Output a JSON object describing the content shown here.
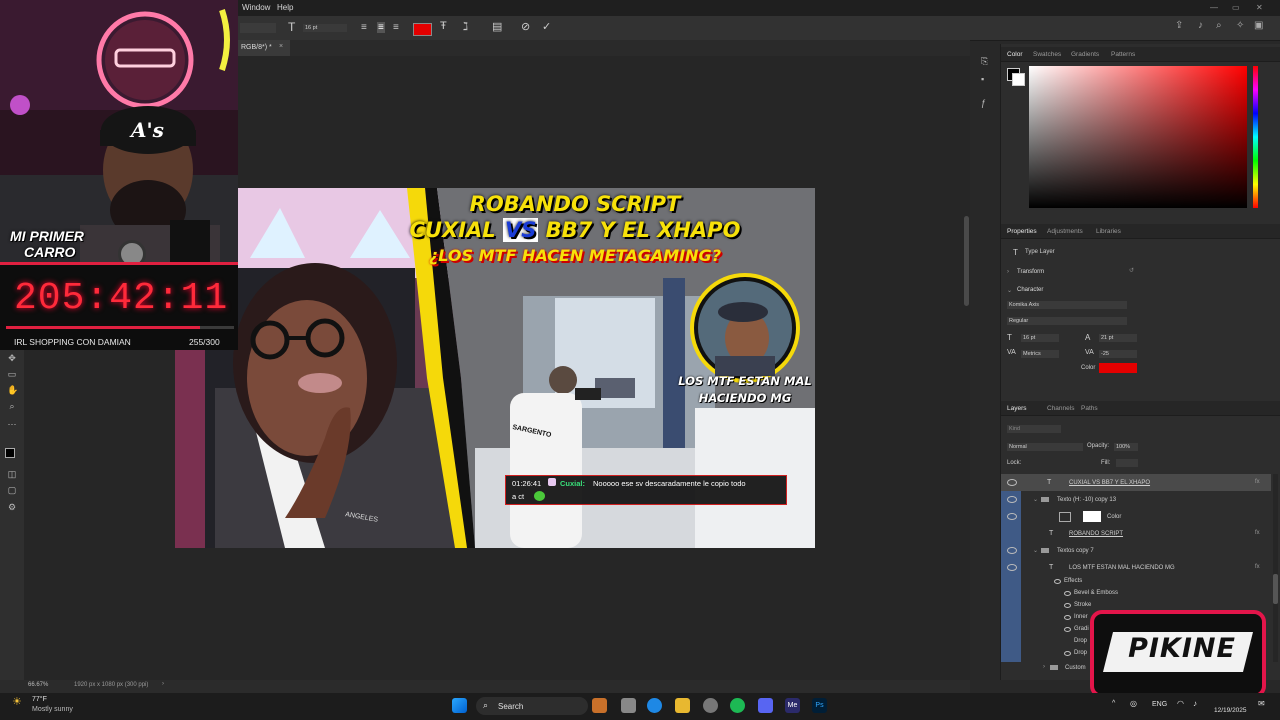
{
  "menubar": {
    "items": [
      "Window",
      "Help"
    ]
  },
  "options_bar": {
    "font_size": "16 pt",
    "text_color": "#e40000"
  },
  "document": {
    "tab_label": "RGB/8*) *",
    "zoom": "66.67%",
    "doc_info": "1920 px x 1080 px (300 ppi)"
  },
  "thumbnail": {
    "line1": "ROBANDO SCRIPT",
    "line2_a": "CUXIAL",
    "line2_vs": "VS",
    "line2_b": "BB7 Y EL XHAPO",
    "line3": "¿LOS MTF HACEN METAGAMING?",
    "caption1": "LOS MTF ESTAN MAL",
    "caption2": "HACIENDO MG",
    "shirt_text": "SARGENTO",
    "sleeve_text": "ANGELES",
    "chat_time": "01:26:41",
    "chat_user": "Cuxial:",
    "chat_msg1": "Nooooo ese sv descaradamente le copio todo",
    "chat_msg2": "a ct"
  },
  "stream_overlay": {
    "cam_badge_line1": "MI PRIMER",
    "cam_badge_line2": "CARRO",
    "cap_logo": "A's",
    "timer": "205:42:11",
    "goal_label": "IRL SHOPPING CON DAMIAN",
    "goal_count": "255/300",
    "goal_progress": 0.85,
    "brand": "PIKINE"
  },
  "panels": {
    "color_tabs": [
      "Color",
      "Swatches",
      "Gradients",
      "Patterns"
    ],
    "props_tabs": [
      "Properties",
      "Adjustments",
      "Libraries"
    ],
    "props_type": "Type Layer",
    "transform": "Transform",
    "character": "Character",
    "font_family": "Komika Axis",
    "font_style": "Regular",
    "size": "16 pt",
    "leading": "21 pt",
    "kerning": "Metrics",
    "tracking": "-25",
    "color_label": "Color",
    "text_color": "#e40000",
    "layers_tabs": [
      "Layers",
      "Channels",
      "Paths"
    ],
    "search_placeholder": "Kind",
    "blend": "Normal",
    "opacity_label": "Opacity:",
    "opacity": "100%",
    "lock_label": "Lock:",
    "fill_label": "Fill:",
    "layers": [
      {
        "name": "CUXIAL VS BB7 Y EL XHAPO"
      },
      {
        "name": "Texto (H: -10) copy 13"
      },
      {
        "name": "Color"
      },
      {
        "name": "ROBANDO SCRIPT"
      },
      {
        "name": "Textos copy 7"
      },
      {
        "name": "LOS MTF ESTAN MAL HACIENDO MG"
      },
      {
        "name": "Effects"
      },
      {
        "name": "Bevel & Emboss"
      },
      {
        "name": "Stroke"
      },
      {
        "name": "Inner"
      },
      {
        "name": "Gradi"
      },
      {
        "name": "Drop"
      },
      {
        "name": "Drop"
      },
      {
        "name": "Custom"
      }
    ]
  },
  "taskbar": {
    "temp": "77°F",
    "weather": "Mostly sunny",
    "search": "Search",
    "lang": "ENG",
    "date": "12/19/2025"
  }
}
